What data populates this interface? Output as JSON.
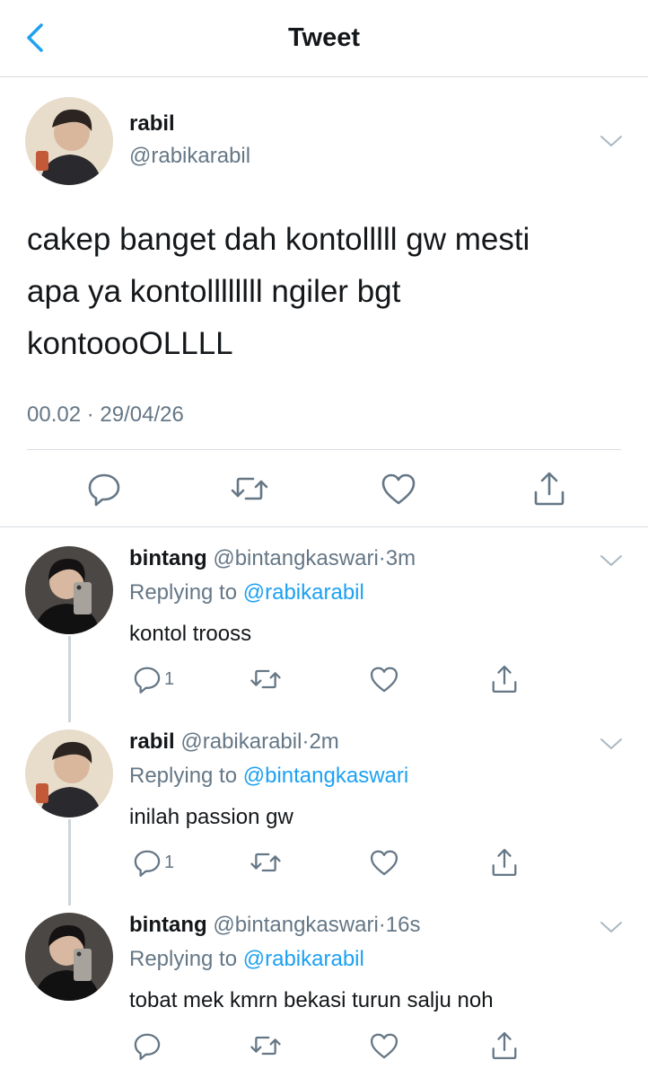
{
  "header": {
    "title": "Tweet"
  },
  "tweet": {
    "name": "rabil",
    "handle": "@rabikarabil",
    "text_lines": [
      "cakep banget dah kontolllll gw mesti",
      "apa ya kontollllllll ngiler bgt",
      "kontoooOLLLL"
    ],
    "timestamp": "00.02 · 29/04/26"
  },
  "replies": [
    {
      "name": "bintang",
      "handle": "@bintangkaswari",
      "dot": "·",
      "time": "3m",
      "replying_prefix": "Replying to ",
      "replying_to": "@rabikarabil",
      "text": "kontol trooss",
      "reply_count": "1"
    },
    {
      "name": "rabil",
      "handle": "@rabikarabil",
      "dot": "·",
      "time": "2m",
      "replying_prefix": "Replying to ",
      "replying_to": "@bintangkaswari",
      "text": "inilah passion gw",
      "reply_count": "1"
    },
    {
      "name": "bintang",
      "handle": "@bintangkaswari",
      "dot": "·",
      "time": "16s",
      "replying_prefix": "Replying to ",
      "replying_to": "@rabikarabil",
      "text": "tobat mek kmrn bekasi turun salju noh",
      "reply_count": ""
    }
  ],
  "icons": {
    "back": "chevron-left-icon",
    "more": "chevron-down-icon",
    "reply": "reply-icon",
    "retweet": "retweet-icon",
    "like": "heart-icon",
    "share": "share-icon"
  },
  "colors": {
    "accent": "#1da1f2",
    "secondary_text": "#657786",
    "divider": "#d8dde2"
  }
}
